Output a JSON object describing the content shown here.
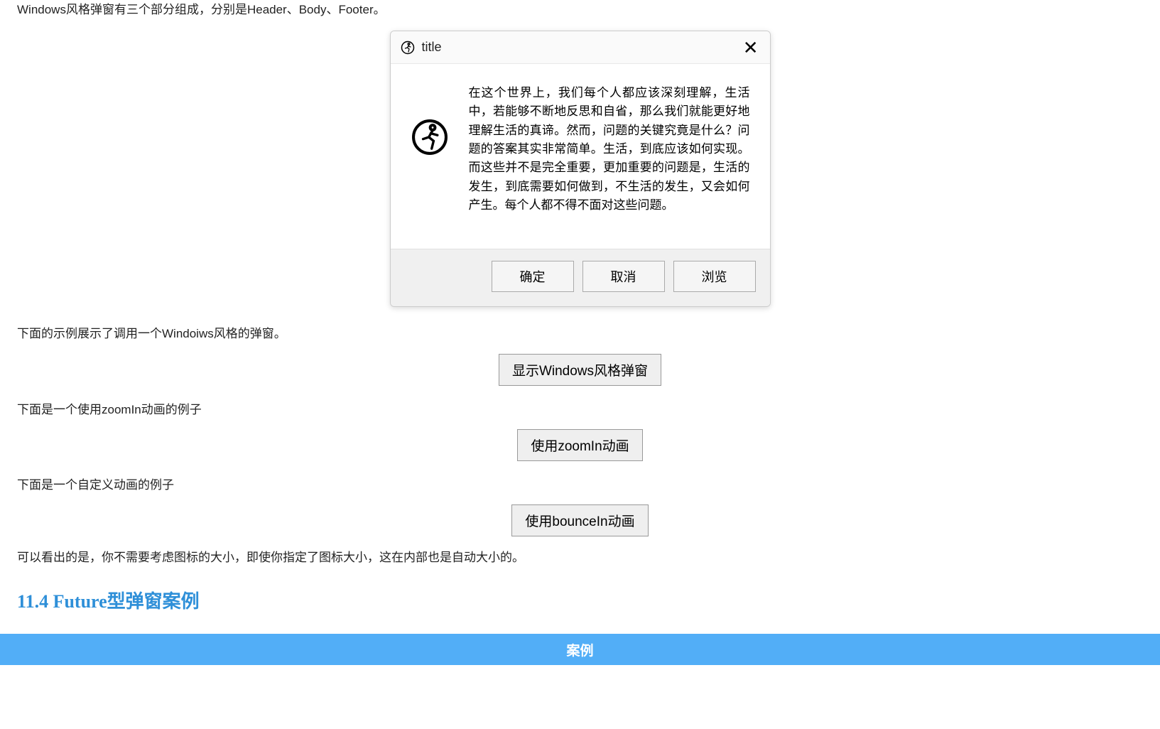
{
  "intro": "Windows风格弹窗有三个部分组成，分别是Header、Body、Footer。",
  "dialog": {
    "title": "title",
    "body": "在这个世界上，我们每个人都应该深刻理解，生活中，若能够不断地反思和自省，那么我们就能更好地理解生活的真谛。然而，问题的关键究竟是什么？问题的答案其实非常简单。生活，到底应该如何实现。而这些并不是完全重要，更加重要的问题是，生活的发生，到底需要如何做到，不生活的发生，又会如何产生。每个人都不得不面对这些问题。",
    "buttons": {
      "ok": "确定",
      "cancel": "取消",
      "browse": "浏览"
    }
  },
  "desc1": "下面的示例展示了调用一个Windoiws风格的弹窗。",
  "btn_windows": "显示Windows风格弹窗",
  "desc2": "下面是一个使用zoomIn动画的例子",
  "btn_zoomin": "使用zoomIn动画",
  "desc3": "下面是一个自定义动画的例子",
  "btn_bouncein": "使用bounceIn动画",
  "note": "可以看出的是，你不需要考虑图标的大小，即使你指定了图标大小，这在内部也是自动大小的。",
  "section_heading": "11.4 Future型弹窗案例",
  "case_banner": "案例"
}
